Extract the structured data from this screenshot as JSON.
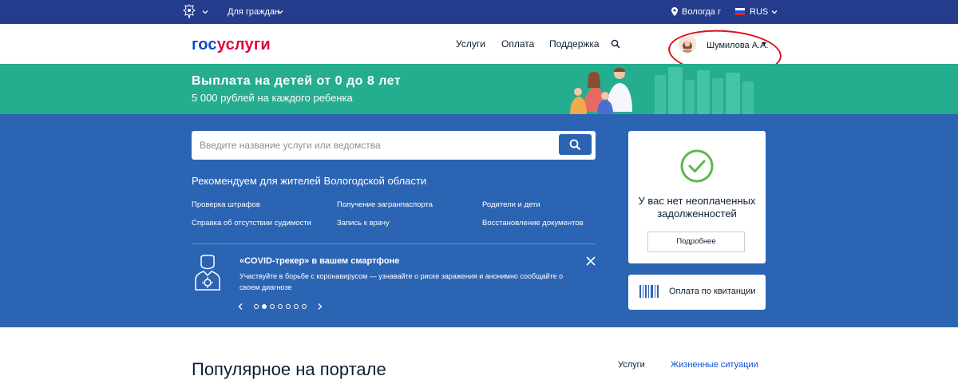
{
  "topbar": {
    "audience": "Для граждан",
    "city": "Вологда г",
    "language": "RUS"
  },
  "header": {
    "logo_part1": "гос",
    "logo_part2": "услуги",
    "nav": [
      "Услуги",
      "Оплата",
      "Поддержка"
    ],
    "user_name": "Шумилова А.А."
  },
  "banner": {
    "title": "Выплата на детей от 0 до 8 лет",
    "subtitle": "5 000 рублей на каждого ребенка"
  },
  "search": {
    "placeholder": "Введите название услуги или ведомства"
  },
  "recommend": {
    "title": "Рекомендуем для жителей Вологодской области",
    "links": [
      "Проверка штрафов",
      "Получение загранпаспорта",
      "Родители и дети",
      "Справка об отсутствии судимости",
      "Запись к врачу",
      "Восстановление документов"
    ]
  },
  "covid": {
    "title": "«COVID-трекер» в вашем смартфоне",
    "description": "Участвуйте в борьбе с коронавирусом — узнавайте о риске заражения и анонимно сообщайте о своем диагнозе",
    "slides_total": 7,
    "slide_active": 2
  },
  "debt_card": {
    "text": "У вас нет неоплаченных задолженностей",
    "button": "Подробнее"
  },
  "receipt_card": {
    "text": "Оплата по квитанции"
  },
  "popular": {
    "title": "Популярное на портале",
    "tabs": [
      "Услуги",
      "Жизненные ситуации"
    ]
  },
  "colors": {
    "topbar": "#253c8c",
    "banner": "#24ad8f",
    "main": "#2c64b4",
    "accent": "#0d4cd3",
    "check": "#5cb84b",
    "annotation": "#d7141a"
  }
}
